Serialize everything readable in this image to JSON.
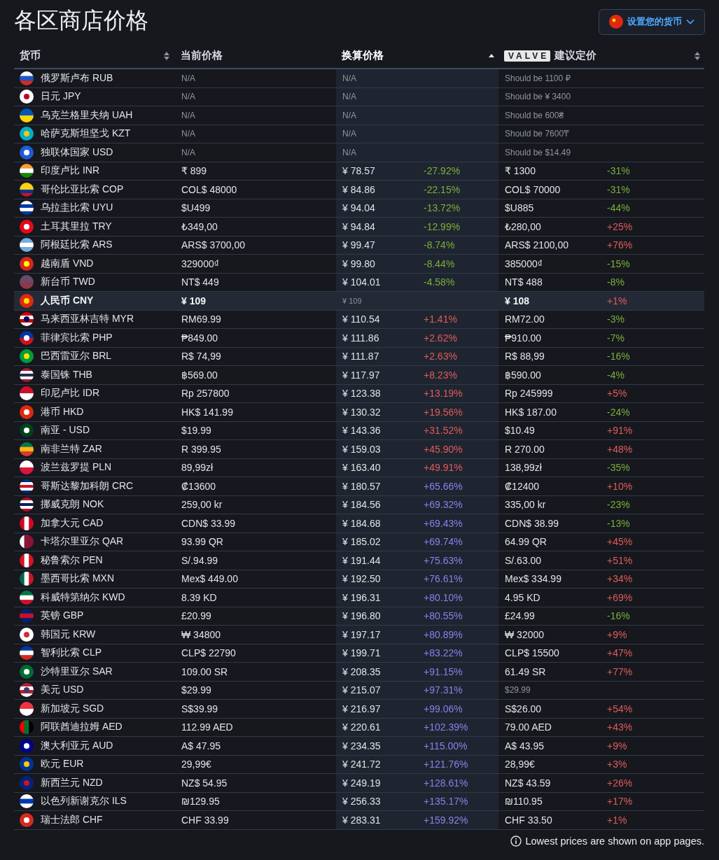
{
  "title": "各区商店价格",
  "currency_button": {
    "label": "设置您的货币"
  },
  "columns": [
    {
      "label": "货币",
      "sortable": true,
      "sorted": false
    },
    {
      "label": "当前价格",
      "sortable": false,
      "sorted": false
    },
    {
      "label": "换算价格",
      "sortable": true,
      "sorted": true
    },
    {
      "label": "建议定价",
      "badge": "VALVE",
      "sortable": true,
      "sorted": false
    }
  ],
  "rows": [
    {
      "kind": "unavailable",
      "currency": "俄罗斯卢布 RUB",
      "current": "N/A",
      "converted": "N/A",
      "suggested": "Should be 1100 ₽"
    },
    {
      "kind": "unavailable",
      "currency": "日元 JPY",
      "current": "N/A",
      "converted": "N/A",
      "suggested": "Should be ¥ 3400"
    },
    {
      "kind": "unavailable",
      "currency": "乌克兰格里夫纳 UAH",
      "current": "N/A",
      "converted": "N/A",
      "suggested": "Should be 600₴"
    },
    {
      "kind": "unavailable",
      "currency": "哈萨克斯坦坚戈 KZT",
      "current": "N/A",
      "converted": "N/A",
      "suggested": "Should be 7600₸"
    },
    {
      "kind": "unavailable",
      "currency": "独联体国家 USD",
      "current": "N/A",
      "converted": "N/A",
      "suggested": "Should be $14.49"
    },
    {
      "kind": "normal",
      "currency": "印度卢比 INR",
      "current": "₹ 899",
      "converted": "¥ 78.57",
      "converted_diff": {
        "text": "-27.92%",
        "color": "#7bb03c"
      },
      "suggested": "₹ 1300",
      "suggested_diff": {
        "text": "-31%",
        "color": "#7bb03c"
      }
    },
    {
      "kind": "normal",
      "currency": "哥伦比亚比索 COP",
      "current": "COL$ 48000",
      "converted": "¥ 84.86",
      "converted_diff": {
        "text": "-22.15%",
        "color": "#7bb03c"
      },
      "suggested": "COL$ 70000",
      "suggested_diff": {
        "text": "-31%",
        "color": "#7bb03c"
      }
    },
    {
      "kind": "normal",
      "currency": "乌拉圭比索 UYU",
      "current": "$U499",
      "converted": "¥ 94.04",
      "converted_diff": {
        "text": "-13.72%",
        "color": "#7bb03c"
      },
      "suggested": "$U885",
      "suggested_diff": {
        "text": "-44%",
        "color": "#7bb03c"
      }
    },
    {
      "kind": "normal",
      "currency": "土耳其里拉 TRY",
      "current": "₺349,00",
      "converted": "¥ 94.84",
      "converted_diff": {
        "text": "-12.99%",
        "color": "#7bb03c"
      },
      "suggested": "₺280,00",
      "suggested_diff": {
        "text": "+25%",
        "color": "#e05c5c"
      }
    },
    {
      "kind": "normal",
      "currency": "阿根廷比索 ARS",
      "current": "ARS$ 3700,00",
      "converted": "¥ 99.47",
      "converted_diff": {
        "text": "-8.74%",
        "color": "#7bb03c"
      },
      "suggested": "ARS$ 2100,00",
      "suggested_diff": {
        "text": "+76%",
        "color": "#e05c5c"
      }
    },
    {
      "kind": "normal",
      "currency": "越南盾 VND",
      "current": "329000₫",
      "converted": "¥ 99.80",
      "converted_diff": {
        "text": "-8.44%",
        "color": "#7bb03c"
      },
      "suggested": "385000₫",
      "suggested_diff": {
        "text": "-15%",
        "color": "#7bb03c"
      }
    },
    {
      "kind": "normal",
      "currency": "新台币 TWD",
      "current": "NT$ 449",
      "converted": "¥ 104.01",
      "converted_diff": {
        "text": "-4.58%",
        "color": "#7bb03c"
      },
      "suggested": "NT$ 488",
      "suggested_diff": {
        "text": "-8%",
        "color": "#7bb03c"
      }
    },
    {
      "kind": "home",
      "currency": "人民币 CNY",
      "current": "¥ 109",
      "converted": "¥ 109",
      "suggested": "¥ 108",
      "suggested_diff": {
        "text": "+1%",
        "color": "#e05c5c"
      }
    },
    {
      "kind": "normal",
      "currency": "马来西亚林吉特 MYR",
      "current": "RM69.99",
      "converted": "¥ 110.54",
      "converted_diff": {
        "text": "+1.41%",
        "color": "#e05c5c"
      },
      "suggested": "RM72.00",
      "suggested_diff": {
        "text": "-3%",
        "color": "#7bb03c"
      }
    },
    {
      "kind": "normal",
      "currency": "菲律宾比索 PHP",
      "current": "₱849.00",
      "converted": "¥ 111.86",
      "converted_diff": {
        "text": "+2.62%",
        "color": "#e05c5c"
      },
      "suggested": "₱910.00",
      "suggested_diff": {
        "text": "-7%",
        "color": "#7bb03c"
      }
    },
    {
      "kind": "normal",
      "currency": "巴西雷亚尔 BRL",
      "current": "R$ 74,99",
      "converted": "¥ 111.87",
      "converted_diff": {
        "text": "+2.63%",
        "color": "#e05c5c"
      },
      "suggested": "R$ 88,99",
      "suggested_diff": {
        "text": "-16%",
        "color": "#7bb03c"
      }
    },
    {
      "kind": "normal",
      "currency": "泰国铢 THB",
      "current": "฿569.00",
      "converted": "¥ 117.97",
      "converted_diff": {
        "text": "+8.23%",
        "color": "#e05c5c"
      },
      "suggested": "฿590.00",
      "suggested_diff": {
        "text": "-4%",
        "color": "#7bb03c"
      }
    },
    {
      "kind": "normal",
      "currency": "印尼卢比 IDR",
      "current": "Rp 257800",
      "converted": "¥ 123.38",
      "converted_diff": {
        "text": "+13.19%",
        "color": "#e05c5c"
      },
      "suggested": "Rp 245999",
      "suggested_diff": {
        "text": "+5%",
        "color": "#e05c5c"
      }
    },
    {
      "kind": "normal",
      "currency": "港币 HKD",
      "current": "HK$ 141.99",
      "converted": "¥ 130.32",
      "converted_diff": {
        "text": "+19.56%",
        "color": "#e05c5c"
      },
      "suggested": "HK$ 187.00",
      "suggested_diff": {
        "text": "-24%",
        "color": "#7bb03c"
      }
    },
    {
      "kind": "normal",
      "currency": "南亚 - USD",
      "current": "$19.99",
      "converted": "¥ 143.36",
      "converted_diff": {
        "text": "+31.52%",
        "color": "#e05c5c"
      },
      "suggested": "$10.49",
      "suggested_diff": {
        "text": "+91%",
        "color": "#e05c5c"
      }
    },
    {
      "kind": "normal",
      "currency": "南非兰特 ZAR",
      "current": "R 399.95",
      "converted": "¥ 159.03",
      "converted_diff": {
        "text": "+45.90%",
        "color": "#e05c5c"
      },
      "suggested": "R 270.00",
      "suggested_diff": {
        "text": "+48%",
        "color": "#e05c5c"
      }
    },
    {
      "kind": "normal",
      "currency": "波兰兹罗提 PLN",
      "current": "89,99zł",
      "converted": "¥ 163.40",
      "converted_diff": {
        "text": "+49.91%",
        "color": "#e05c5c"
      },
      "suggested": "138,99zł",
      "suggested_diff": {
        "text": "-35%",
        "color": "#7bb03c"
      }
    },
    {
      "kind": "normal",
      "currency": "哥斯达黎加科朗 CRC",
      "current": "₡13600",
      "converted": "¥ 180.57",
      "converted_diff": {
        "text": "+65.66%",
        "color": "#8b80ec"
      },
      "suggested": "₡12400",
      "suggested_diff": {
        "text": "+10%",
        "color": "#e05c5c"
      }
    },
    {
      "kind": "normal",
      "currency": "挪威克朗 NOK",
      "current": "259,00 kr",
      "converted": "¥ 184.56",
      "converted_diff": {
        "text": "+69.32%",
        "color": "#8b80ec"
      },
      "suggested": "335,00 kr",
      "suggested_diff": {
        "text": "-23%",
        "color": "#7bb03c"
      }
    },
    {
      "kind": "normal",
      "currency": "加拿大元 CAD",
      "current": "CDN$ 33.99",
      "converted": "¥ 184.68",
      "converted_diff": {
        "text": "+69.43%",
        "color": "#8b80ec"
      },
      "suggested": "CDN$ 38.99",
      "suggested_diff": {
        "text": "-13%",
        "color": "#7bb03c"
      }
    },
    {
      "kind": "normal",
      "currency": "卡塔尔里亚尔 QAR",
      "current": "93.99 QR",
      "converted": "¥ 185.02",
      "converted_diff": {
        "text": "+69.74%",
        "color": "#8b80ec"
      },
      "suggested": "64.99 QR",
      "suggested_diff": {
        "text": "+45%",
        "color": "#e05c5c"
      }
    },
    {
      "kind": "normal",
      "currency": "秘鲁索尔 PEN",
      "current": "S/.94.99",
      "converted": "¥ 191.44",
      "converted_diff": {
        "text": "+75.63%",
        "color": "#8b80ec"
      },
      "suggested": "S/.63.00",
      "suggested_diff": {
        "text": "+51%",
        "color": "#e05c5c"
      }
    },
    {
      "kind": "normal",
      "currency": "墨西哥比索 MXN",
      "current": "Mex$ 449.00",
      "converted": "¥ 192.50",
      "converted_diff": {
        "text": "+76.61%",
        "color": "#8b80ec"
      },
      "suggested": "Mex$ 334.99",
      "suggested_diff": {
        "text": "+34%",
        "color": "#e05c5c"
      }
    },
    {
      "kind": "normal",
      "currency": "科威特第纳尔 KWD",
      "current": "8.39 KD",
      "converted": "¥ 196.31",
      "converted_diff": {
        "text": "+80.10%",
        "color": "#8b80ec"
      },
      "suggested": "4.95 KD",
      "suggested_diff": {
        "text": "+69%",
        "color": "#e05c5c"
      }
    },
    {
      "kind": "normal",
      "currency": "英镑 GBP",
      "current": "£20.99",
      "converted": "¥ 196.80",
      "converted_diff": {
        "text": "+80.55%",
        "color": "#8b80ec"
      },
      "suggested": "£24.99",
      "suggested_diff": {
        "text": "-16%",
        "color": "#7bb03c"
      }
    },
    {
      "kind": "normal",
      "currency": "韩国元 KRW",
      "current": "₩ 34800",
      "converted": "¥ 197.17",
      "converted_diff": {
        "text": "+80.89%",
        "color": "#8b80ec"
      },
      "suggested": "₩ 32000",
      "suggested_diff": {
        "text": "+9%",
        "color": "#e05c5c"
      }
    },
    {
      "kind": "normal",
      "currency": "智利比索 CLP",
      "current": "CLP$ 22790",
      "converted": "¥ 199.71",
      "converted_diff": {
        "text": "+83.22%",
        "color": "#8b80ec"
      },
      "suggested": "CLP$ 15500",
      "suggested_diff": {
        "text": "+47%",
        "color": "#e05c5c"
      }
    },
    {
      "kind": "normal",
      "currency": "沙特里亚尔 SAR",
      "current": "109.00 SR",
      "converted": "¥ 208.35",
      "converted_diff": {
        "text": "+91.15%",
        "color": "#8b80ec"
      },
      "suggested": "61.49 SR",
      "suggested_diff": {
        "text": "+77%",
        "color": "#e05c5c"
      }
    },
    {
      "kind": "reference",
      "currency": "美元 USD",
      "current": "$29.99",
      "converted": "¥ 215.07",
      "converted_diff": {
        "text": "+97.31%",
        "color": "#8b80ec"
      },
      "suggested": "$29.99"
    },
    {
      "kind": "normal",
      "currency": "新加坡元 SGD",
      "current": "S$39.99",
      "converted": "¥ 216.97",
      "converted_diff": {
        "text": "+99.06%",
        "color": "#8b80ec"
      },
      "suggested": "S$26.00",
      "suggested_diff": {
        "text": "+54%",
        "color": "#e05c5c"
      }
    },
    {
      "kind": "normal",
      "currency": "阿联酋迪拉姆 AED",
      "current": "112.99 AED",
      "converted": "¥ 220.61",
      "converted_diff": {
        "text": "+102.39%",
        "color": "#8b80ec"
      },
      "suggested": "79.00 AED",
      "suggested_diff": {
        "text": "+43%",
        "color": "#e05c5c"
      }
    },
    {
      "kind": "normal",
      "currency": "澳大利亚元 AUD",
      "current": "A$ 47.95",
      "converted": "¥ 234.35",
      "converted_diff": {
        "text": "+115.00%",
        "color": "#8b80ec"
      },
      "suggested": "A$ 43.95",
      "suggested_diff": {
        "text": "+9%",
        "color": "#e05c5c"
      }
    },
    {
      "kind": "normal",
      "currency": "欧元 EUR",
      "current": "29,99€",
      "converted": "¥ 241.72",
      "converted_diff": {
        "text": "+121.76%",
        "color": "#8b80ec"
      },
      "suggested": "28,99€",
      "suggested_diff": {
        "text": "+3%",
        "color": "#e05c5c"
      }
    },
    {
      "kind": "normal",
      "currency": "新西兰元 NZD",
      "current": "NZ$ 54.95",
      "converted": "¥ 249.19",
      "converted_diff": {
        "text": "+128.61%",
        "color": "#8b80ec"
      },
      "suggested": "NZ$ 43.59",
      "suggested_diff": {
        "text": "+26%",
        "color": "#e05c5c"
      }
    },
    {
      "kind": "normal",
      "currency": "以色列新谢克尔 ILS",
      "current": "₪129.95",
      "converted": "¥ 256.33",
      "converted_diff": {
        "text": "+135.17%",
        "color": "#8b80ec"
      },
      "suggested": "₪110.95",
      "suggested_diff": {
        "text": "+17%",
        "color": "#e05c5c"
      }
    },
    {
      "kind": "normal",
      "currency": "瑞士法郎 CHF",
      "current": "CHF 33.99",
      "converted": "¥ 283.31",
      "converted_diff": {
        "text": "+159.92%",
        "color": "#8b80ec"
      },
      "suggested": "CHF 33.50",
      "suggested_diff": {
        "text": "+1%",
        "color": "#e05c5c"
      }
    }
  ],
  "footnote": "Lowest prices are shown on app pages."
}
